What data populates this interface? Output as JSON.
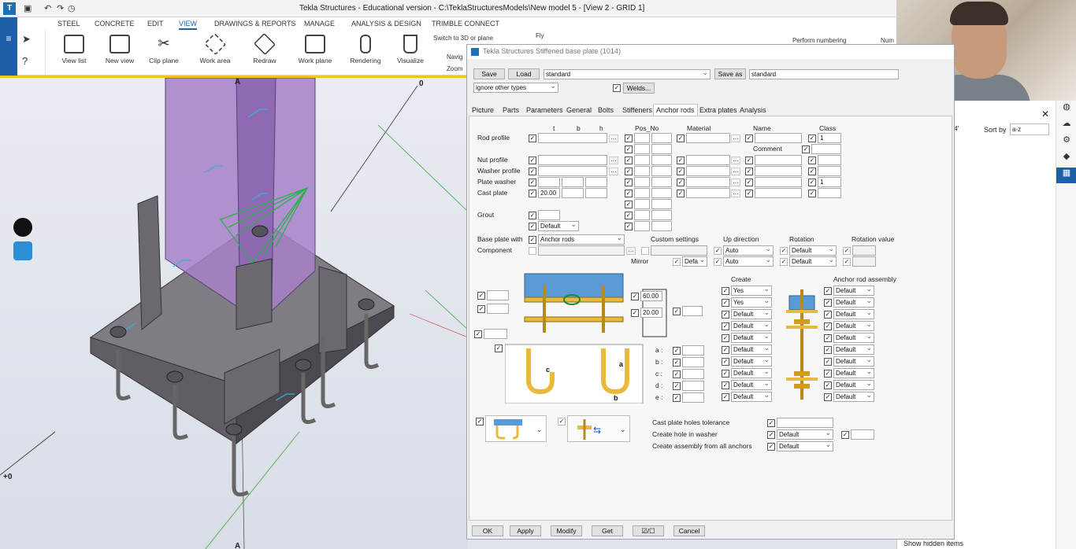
{
  "window": {
    "title": "Tekla Structures - Educational version - C:\\TeklaStructuresModels\\New model 5  - [View 2 - GRID 1]"
  },
  "ribbon": {
    "tabs": [
      "STEEL",
      "CONCRETE",
      "EDIT",
      "VIEW",
      "DRAWINGS & REPORTS",
      "MANAGE",
      "ANALYSIS & DESIGN",
      "TRIMBLE CONNECT"
    ],
    "active_tab": "VIEW",
    "buttons": [
      "View list",
      "New view",
      "Clip plane",
      "Work area",
      "Redraw",
      "Work plane",
      "Rendering",
      "Visualize"
    ],
    "small": {
      "switch3d": "Switch to 3D or plane",
      "fly": "Fly",
      "navigate": "Navig",
      "zoom": "Zoom",
      "perform_numbering": "Perform numbering",
      "numbering": "Num"
    }
  },
  "viewport": {
    "grid_labels": [
      "A",
      "0",
      "+0",
      "A"
    ],
    "accent": "#f2c318"
  },
  "right_panel": {
    "sort_by": "Sort by",
    "sort_value": "a-z",
    "show_hidden": "Show hidden items",
    "partial_value": "4'"
  },
  "dialog": {
    "title": "Tekla Structures  Stiffened base plate (1014)",
    "save": "Save",
    "load": "Load",
    "load_value": "standard",
    "save_as": "Save as",
    "save_as_value": "standard",
    "filter": "ignore other types",
    "welds": "Welds...",
    "tabs": [
      "Picture",
      "Parts",
      "Parameters",
      "General",
      "Bolts",
      "Stiffeners",
      "Anchor rods",
      "Extra plates",
      "Analysis"
    ],
    "active_tab": "Anchor rods",
    "col_headers": {
      "t": "t",
      "b": "b",
      "h": "h",
      "pos": "Pos_No",
      "material": "Material",
      "name": "Name",
      "class": "Class",
      "comment": "Comment"
    },
    "rows": {
      "rod_profile": "Rod profile",
      "rod_class": "1",
      "nut_profile": "Nut profile",
      "washer_profile": "Washer profile",
      "plate_washer": "Plate washer",
      "plate_washer_class": "1",
      "cast_plate": "Cast plate",
      "cast_plate_t": "20.00",
      "grout": "Grout",
      "grout_value": "Default"
    },
    "base_plate_with": "Base plate with",
    "base_plate_value": "Anchor rods",
    "component": "Component",
    "custom_settings": "Custom settings",
    "mirror": "Mirror",
    "mirror_value": "Defa",
    "up_direction": "Up direction",
    "up_values": [
      "Auto",
      "Auto"
    ],
    "rotation": "Rotation",
    "rotation_values": [
      "Default",
      "Default"
    ],
    "rotation_value": "Rotation value",
    "dim_60": "60.00",
    "dim_20": "20.00",
    "diag_letters": {
      "a": "a",
      "b": "b",
      "c": "c"
    },
    "dims": [
      "a :",
      "b :",
      "c :",
      "d :",
      "e :"
    ],
    "create": "Create",
    "create_values": [
      "Yes",
      "Yes",
      "Default",
      "Default",
      "Default",
      "Default",
      "Default",
      "Default",
      "Default",
      "Default"
    ],
    "assembly": "Anchor rod assembly",
    "assembly_values": [
      "Default",
      "Default",
      "Default",
      "Default",
      "Default",
      "Default",
      "Default",
      "Default",
      "Default",
      "Default"
    ],
    "cast_tol": "Cast plate holes tolerance",
    "hole_washer": "Create hole in washer",
    "hole_washer_value": "Default",
    "assembly_all": "Create assembly from all anchors",
    "assembly_all_value": "Default",
    "footer": [
      "OK",
      "Apply",
      "Modify",
      "Get",
      "☑/☐",
      "Cancel"
    ]
  }
}
